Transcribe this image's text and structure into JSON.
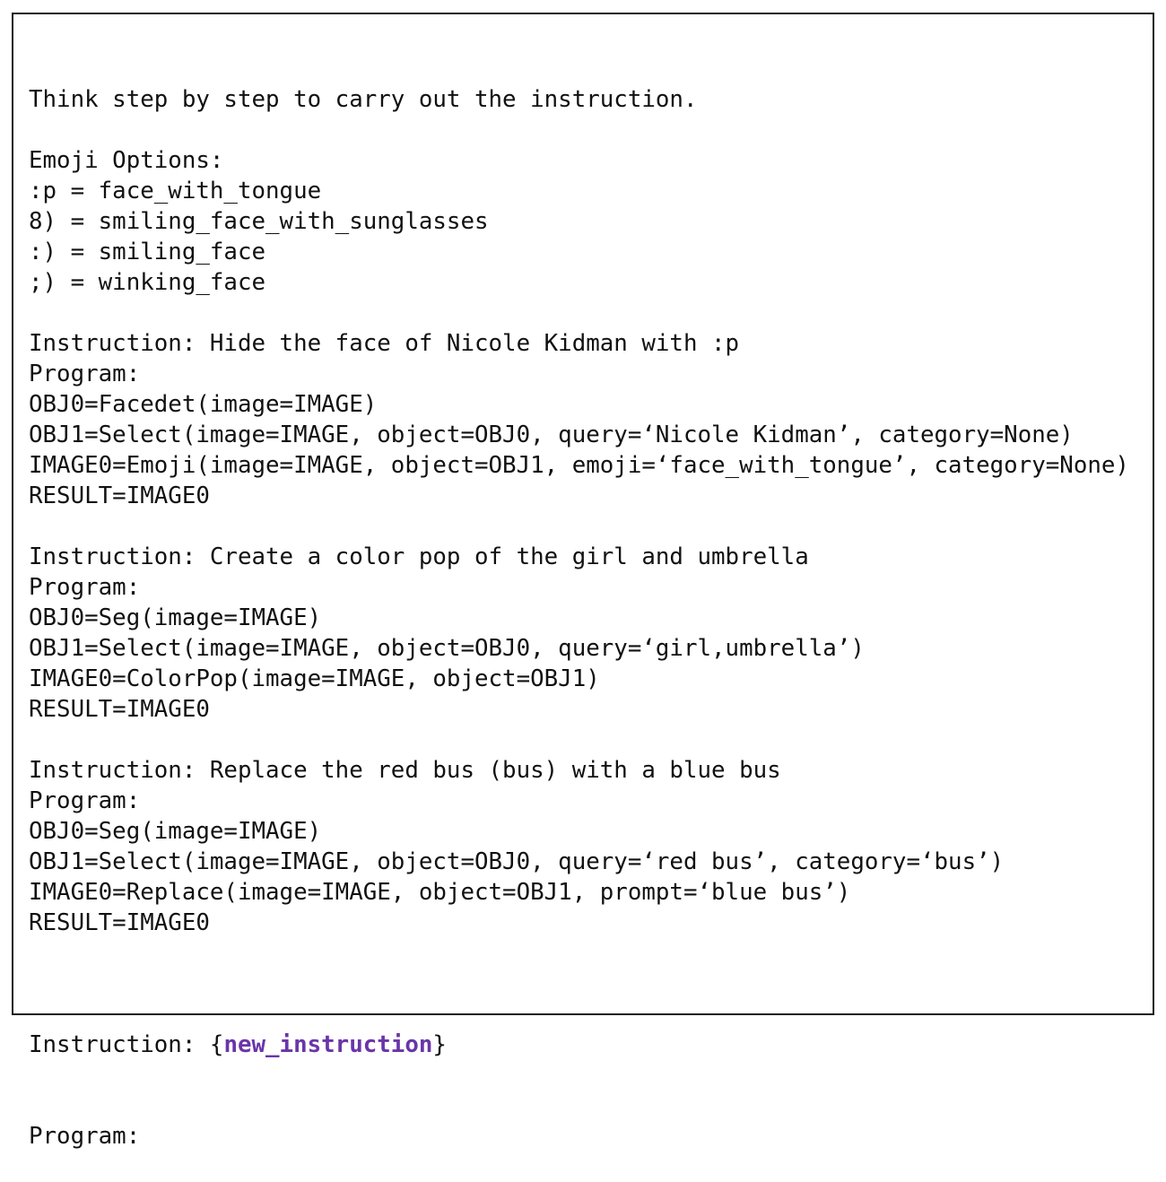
{
  "lines": [
    "Think step by step to carry out the instruction.",
    "",
    "Emoji Options:",
    ":p = face_with_tongue",
    "8) = smiling_face_with_sunglasses",
    ":) = smiling_face",
    ";) = winking_face",
    "",
    "Instruction: Hide the face of Nicole Kidman with :p",
    "Program:",
    "OBJ0=Facedet(image=IMAGE)",
    "OBJ1=Select(image=IMAGE, object=OBJ0, query=‘Nicole Kidman’, category=None)",
    "IMAGE0=Emoji(image=IMAGE, object=OBJ1, emoji=‘face_with_tongue’, category=None)",
    "RESULT=IMAGE0",
    "",
    "Instruction: Create a color pop of the girl and umbrella",
    "Program:",
    "OBJ0=Seg(image=IMAGE)",
    "OBJ1=Select(image=IMAGE, object=OBJ0, query=‘girl,umbrella’)",
    "IMAGE0=ColorPop(image=IMAGE, object=OBJ1)",
    "RESULT=IMAGE0",
    "",
    "Instruction: Replace the red bus (bus) with a blue bus",
    "Program:",
    "OBJ0=Seg(image=IMAGE)",
    "OBJ1=Select(image=IMAGE, object=OBJ0, query=‘red bus’, category=‘bus’)",
    "IMAGE0=Replace(image=IMAGE, object=OBJ1, prompt=‘blue bus’)",
    "RESULT=IMAGE0",
    ""
  ],
  "final": {
    "prefix": "Instruction: {",
    "placeholder": "new_instruction",
    "suffix": "}",
    "program_label": "Program:"
  },
  "colors": {
    "placeholder": "#6a35a8",
    "text": "#111111",
    "border": "#1a1a1a"
  }
}
